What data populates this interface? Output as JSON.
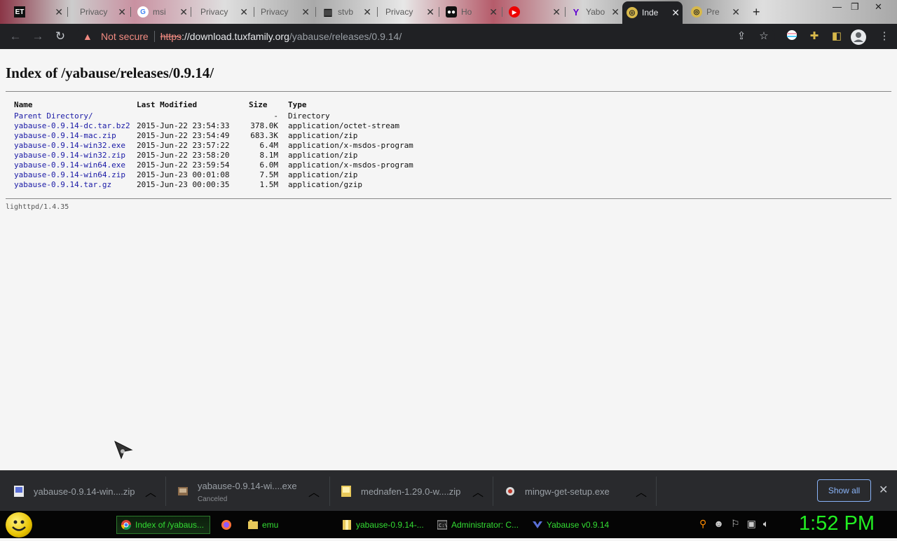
{
  "browser": {
    "tabs": [
      {
        "label": "ET",
        "icon": "et-icon"
      },
      {
        "label": "Privacy",
        "icon": "privacy-icon"
      },
      {
        "label": "msi",
        "icon": "google-icon"
      },
      {
        "label": "Privacy",
        "icon": "privacy-icon"
      },
      {
        "label": "Privacy",
        "icon": "privacy-icon"
      },
      {
        "label": "stvb",
        "icon": "trash-icon"
      },
      {
        "label": "Privacy",
        "icon": "privacy-icon"
      },
      {
        "label": "Ho",
        "icon": "media-icon"
      },
      {
        "label": "",
        "icon": "youtube-icon"
      },
      {
        "label": "Yabo",
        "icon": "yahoo-icon"
      },
      {
        "label": "Inde",
        "icon": "globe-icon"
      },
      {
        "label": "Pre",
        "icon": "globe-icon"
      }
    ],
    "address": {
      "security": "Not secure",
      "scheme": "https",
      "host": "download.tuxfamily.org",
      "path": "/yabause/releases/0.9.14/"
    }
  },
  "page": {
    "title": "Index of /yabause/releases/0.9.14/",
    "columns": [
      "Name",
      "Last Modified",
      "Size",
      "Type"
    ],
    "rows": [
      {
        "name": "Parent Directory/",
        "modified": "",
        "size": "-",
        "type": "Directory"
      },
      {
        "name": "yabause-0.9.14-dc.tar.bz2",
        "modified": "2015-Jun-22 23:54:33",
        "size": "378.0K",
        "type": "application/octet-stream"
      },
      {
        "name": "yabause-0.9.14-mac.zip",
        "modified": "2015-Jun-22 23:54:49",
        "size": "683.3K",
        "type": "application/zip"
      },
      {
        "name": "yabause-0.9.14-win32.exe",
        "modified": "2015-Jun-22 23:57:22",
        "size": "6.4M",
        "type": "application/x-msdos-program"
      },
      {
        "name": "yabause-0.9.14-win32.zip",
        "modified": "2015-Jun-22 23:58:20",
        "size": "8.1M",
        "type": "application/zip"
      },
      {
        "name": "yabause-0.9.14-win64.exe",
        "modified": "2015-Jun-22 23:59:54",
        "size": "6.0M",
        "type": "application/x-msdos-program"
      },
      {
        "name": "yabause-0.9.14-win64.zip",
        "modified": "2015-Jun-23 00:01:08",
        "size": "7.5M",
        "type": "application/zip"
      },
      {
        "name": "yabause-0.9.14.tar.gz",
        "modified": "2015-Jun-23 00:00:35",
        "size": "1.5M",
        "type": "application/gzip"
      }
    ],
    "footer": "lighttpd/1.4.35"
  },
  "downloads": {
    "items": [
      {
        "name": "yabause-0.9.14-win....zip",
        "status": ""
      },
      {
        "name": "yabause-0.9.14-wi....exe",
        "status": "Canceled"
      },
      {
        "name": "mednafen-1.29.0-w....zip",
        "status": ""
      },
      {
        "name": "mingw-get-setup.exe",
        "status": ""
      }
    ],
    "show_all": "Show all"
  },
  "taskbar": {
    "items": [
      {
        "label": "Index of /yabaus...",
        "icon": "chrome-icon",
        "active": true
      },
      {
        "label": "",
        "icon": "firefox-icon",
        "active": false
      },
      {
        "label": "emu",
        "icon": "folder-icon",
        "active": false
      },
      {
        "label": "yabause-0.9.14-...",
        "icon": "archive-icon",
        "active": false
      },
      {
        "label": "Administrator: C...",
        "icon": "cmd-icon",
        "active": false
      },
      {
        "label": "Yabause v0.9.14",
        "icon": "yabause-icon",
        "active": false
      }
    ],
    "clock": "1:52 PM"
  }
}
